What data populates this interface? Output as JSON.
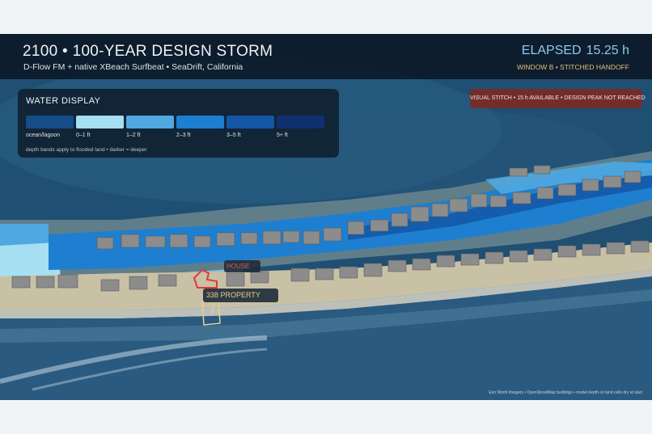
{
  "header": {
    "title": "2100 • 100-YEAR DESIGN STORM",
    "subtitle": "D-Flow FM + native XBeach Surfbeat  •  SeaDrift, California",
    "elapsed_label": "ELAPSED",
    "elapsed_value": "15.25 h",
    "window_label": "WINDOW B • STITCHED HANDOFF"
  },
  "legend": {
    "title": "WATER DISPLAY",
    "items": [
      {
        "label": "ocean/lagoon",
        "color": "#154d86"
      },
      {
        "label": "0–1 ft",
        "color": "#a6def2"
      },
      {
        "label": "1–2 ft",
        "color": "#4fa9e0"
      },
      {
        "label": "2–3 ft",
        "color": "#1e7fd0"
      },
      {
        "label": "3–5 ft",
        "color": "#1456a6"
      },
      {
        "label": "5+ ft",
        "color": "#0f2f6e"
      }
    ],
    "note": "depth bands apply to flooded land • darker = deeper"
  },
  "warning": "VISUAL STITCH • 15 h AVAILABLE • DESIGN PEAK NOT REACHED",
  "map": {
    "house_label": "HOUSE",
    "property_label": "338 PROPERTY",
    "attribution": "Esri World Imagery • OpenStreetMap buildings • model depth on land cells dry at start",
    "colors": {
      "lagoon": "#1f4f73",
      "ocean": "#2a5a80",
      "sand": "#c9c1a6",
      "building": "#8c8c8c",
      "house_outline": "#e03b32",
      "property_outline": "#e8cf83"
    }
  }
}
